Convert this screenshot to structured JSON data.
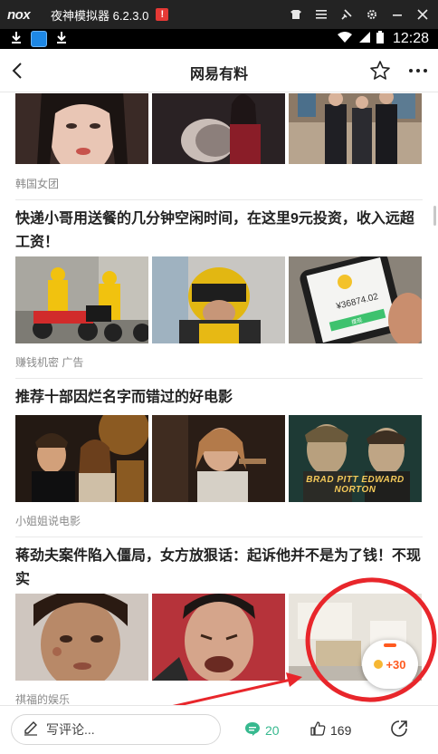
{
  "emulator": {
    "logo": "nox",
    "title": "夜神模拟器 6.2.3.0",
    "alert": "!"
  },
  "status_bar": {
    "time": "12:28"
  },
  "header": {
    "title": "网易有料"
  },
  "feed": {
    "cards": [
      {
        "title": "",
        "source": "韩国女团"
      },
      {
        "title": "快递小哥用送餐的几分钟空闲时间，在这里9元投资，收入远超工资！",
        "source": "赚钱机密 广告",
        "thumb_text": [
          "¥36874.02",
          "提现"
        ]
      },
      {
        "title": "推荐十部因烂名字而错过的好电影",
        "source": "小姐姐说电影",
        "poster_text": "BRAD PITT  EDWARD NORTON"
      },
      {
        "title": "蒋劲夫案件陷入僵局，女方放狠话：起诉他并不是为了钱！不现实",
        "source": "祺福的娱乐"
      }
    ]
  },
  "bottom_bar": {
    "comment_placeholder": "写评论...",
    "comments": "20",
    "likes": "169"
  },
  "reward": {
    "value": "+30"
  },
  "colors": {
    "accent_green": "#37b98f",
    "reward_orange": "#ff5a1f",
    "annotation_red": "#e8262b"
  }
}
